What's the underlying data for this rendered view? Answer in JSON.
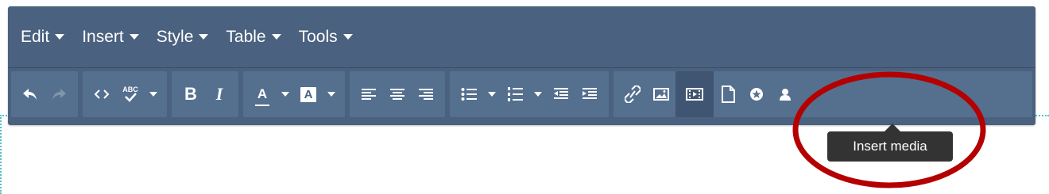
{
  "menubar": {
    "items": [
      {
        "label": "Edit"
      },
      {
        "label": "Insert"
      },
      {
        "label": "Style"
      },
      {
        "label": "Table"
      },
      {
        "label": "Tools"
      }
    ]
  },
  "toolbar": {
    "bold_label": "B",
    "italic_label": "I",
    "text_color_label": "A",
    "bg_color_label": "A",
    "spellcheck_label": "ABC",
    "icons": [
      "undo-icon",
      "redo-icon",
      "source-code-icon",
      "spellcheck-icon",
      "bold-icon",
      "italic-icon",
      "text-color-icon",
      "background-color-icon",
      "align-left-icon",
      "align-center-icon",
      "align-right-icon",
      "bullet-list-icon",
      "numbered-list-icon",
      "outdent-icon",
      "indent-icon",
      "link-icon",
      "image-icon",
      "media-icon",
      "page-icon",
      "special-char-icon",
      "person-icon"
    ],
    "active_button": "media"
  },
  "tooltip": {
    "text": "Insert media"
  },
  "colors": {
    "toolbar_bg": "#4a6180",
    "group_bg": "#55708f",
    "active_bg": "#3f5571",
    "annotation_circle": "#b40000",
    "dotted_guide": "#4fc1c9",
    "tooltip_bg": "#333333"
  }
}
